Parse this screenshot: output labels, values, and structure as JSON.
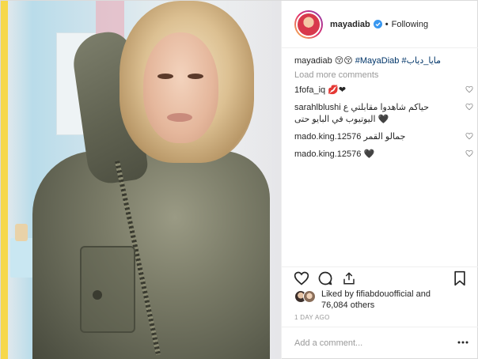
{
  "post": {
    "header": {
      "username": "mayadiab",
      "separator": "•",
      "follow_status": "Following"
    },
    "caption": {
      "username": "mayadiab",
      "emoji": "😚😚",
      "hashtags": "#MayaDiab #مايا_دياب"
    },
    "load_more": "Load more comments",
    "comments": [
      {
        "username": "1fofa_iq",
        "text": "💋❤"
      },
      {
        "username": "sarahlblushi",
        "text": "حياكم شاهدوا مقابلتي ع اليوتيوب في البايو حتى 🖤"
      },
      {
        "username": "mado.king.12576",
        "text": "جمالو القمر"
      },
      {
        "username": "mado.king.12576",
        "text": "🖤"
      }
    ],
    "likes": {
      "line1": "Liked by fifiabdouofficial and",
      "line2": "76,084 others"
    },
    "timestamp": "1 DAY AGO",
    "add_comment_placeholder": "Add a comment..."
  },
  "icons": {
    "heart": "heart-outline-icon",
    "comment": "comment-bubble-icon",
    "share": "share-upload-icon",
    "save": "bookmark-icon",
    "verified": "verified-badge-icon",
    "more": "more-options-icon"
  },
  "colors": {
    "link": "#003569",
    "muted": "#999999",
    "verified": "#3897f0",
    "text": "#262626"
  }
}
